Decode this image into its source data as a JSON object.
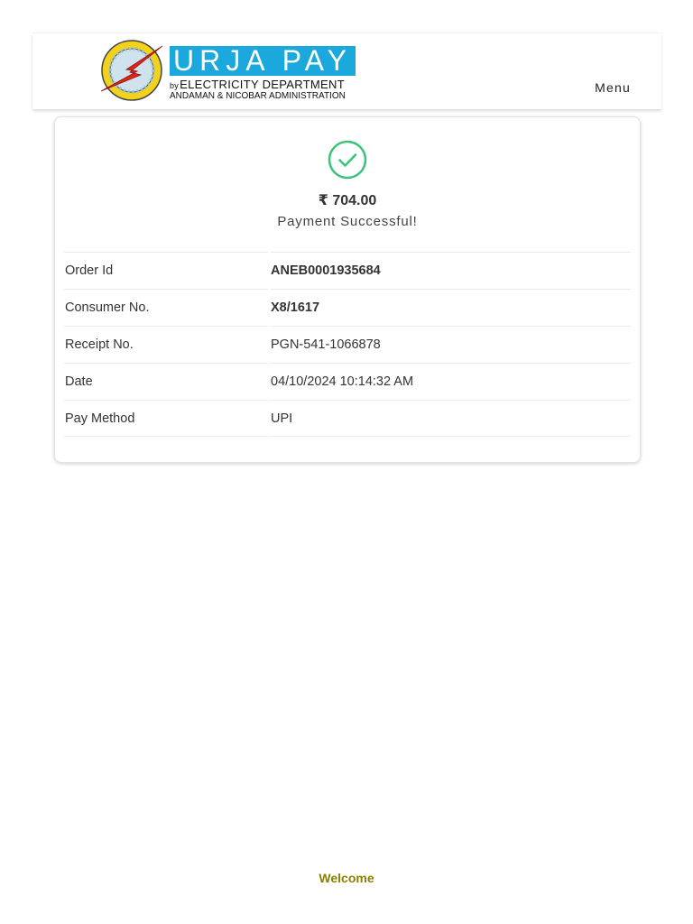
{
  "header": {
    "brand_title": "URJA PAY",
    "brand_by": "by",
    "brand_dept": "ELECTRICITY DEPARTMENT",
    "brand_admin": "ANDAMAN & NICOBAR ADMINISTRATION",
    "menu_label": "Menu",
    "colors": {
      "brand_blue": "#1ba8dd",
      "seal_yellow": "#f3d21c",
      "bolt_red": "#e0251b"
    }
  },
  "receipt": {
    "icon": "check-circle-icon",
    "icon_color": "#3cc27a",
    "amount": "₹ 704.00",
    "status": "Payment Successful!",
    "rows": [
      {
        "label": "Order Id",
        "value": "ANEB0001935684"
      },
      {
        "label": "Consumer No.",
        "value": "X8/1617"
      },
      {
        "label": "Receipt No.",
        "value": "PGN-541-1066878"
      },
      {
        "label": "Date",
        "value": "04/10/2024 10:14:32 AM"
      },
      {
        "label": "Pay Method",
        "value": "UPI"
      }
    ]
  },
  "footer": {
    "welcome": "Welcome",
    "color": "#8a8000"
  }
}
